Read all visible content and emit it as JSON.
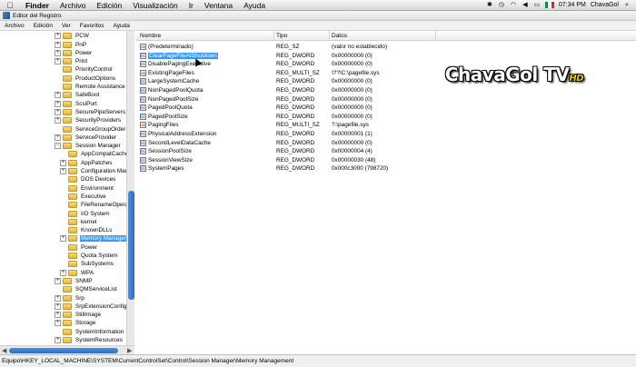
{
  "menubar": {
    "items": [
      "Finder",
      "Archivo",
      "Edición",
      "Visualización",
      "Ir",
      "Ventana",
      "Ayuda"
    ],
    "clock": "07:34 PM",
    "user": "ChavaGol"
  },
  "window": {
    "title": "Editor del Registro",
    "menu": [
      "Archivo",
      "Edición",
      "Ver",
      "Favoritos",
      "Ayuda"
    ]
  },
  "tree": {
    "items": [
      {
        "label": "PCW",
        "indent": 0,
        "expander": "+"
      },
      {
        "label": "PnP",
        "indent": 0,
        "expander": "+"
      },
      {
        "label": "Power",
        "indent": 0,
        "expander": "+"
      },
      {
        "label": "Print",
        "indent": 0,
        "expander": "+"
      },
      {
        "label": "PriorityControl",
        "indent": 0,
        "expander": ""
      },
      {
        "label": "ProductOptions",
        "indent": 0,
        "expander": ""
      },
      {
        "label": "Remote Assistance",
        "indent": 0,
        "expander": ""
      },
      {
        "label": "SafeBoot",
        "indent": 0,
        "expander": "+"
      },
      {
        "label": "ScsiPort",
        "indent": 0,
        "expander": "+"
      },
      {
        "label": "SecurePipeServers",
        "indent": 0,
        "expander": "+"
      },
      {
        "label": "SecurityProviders",
        "indent": 0,
        "expander": "+"
      },
      {
        "label": "ServiceGroupOrder",
        "indent": 0,
        "expander": ""
      },
      {
        "label": "ServiceProvider",
        "indent": 0,
        "expander": "+"
      },
      {
        "label": "Session Manager",
        "indent": 0,
        "expander": "−"
      },
      {
        "label": "AppCompatCache",
        "indent": 1,
        "expander": ""
      },
      {
        "label": "AppPatches",
        "indent": 1,
        "expander": "+"
      },
      {
        "label": "Configuration Manag",
        "indent": 1,
        "expander": "+"
      },
      {
        "label": "DOS Devices",
        "indent": 1,
        "expander": ""
      },
      {
        "label": "Environment",
        "indent": 1,
        "expander": ""
      },
      {
        "label": "Executive",
        "indent": 1,
        "expander": ""
      },
      {
        "label": "FileRenameOperation",
        "indent": 1,
        "expander": ""
      },
      {
        "label": "I/O System",
        "indent": 1,
        "expander": ""
      },
      {
        "label": "kernel",
        "indent": 1,
        "expander": ""
      },
      {
        "label": "KnownDLLs",
        "indent": 1,
        "expander": ""
      },
      {
        "label": "Memory Managemen",
        "indent": 1,
        "expander": "+",
        "selected": true
      },
      {
        "label": "Power",
        "indent": 1,
        "expander": ""
      },
      {
        "label": "Quota System",
        "indent": 1,
        "expander": ""
      },
      {
        "label": "SubSystems",
        "indent": 1,
        "expander": ""
      },
      {
        "label": "WPA",
        "indent": 1,
        "expander": "+"
      },
      {
        "label": "SNMP",
        "indent": 0,
        "expander": "+"
      },
      {
        "label": "SQMServiceList",
        "indent": 0,
        "expander": ""
      },
      {
        "label": "Srp",
        "indent": 0,
        "expander": "+"
      },
      {
        "label": "SrpExtensionConfig",
        "indent": 0,
        "expander": "+"
      },
      {
        "label": "StillImage",
        "indent": 0,
        "expander": "+"
      },
      {
        "label": "Storage",
        "indent": 0,
        "expander": "+"
      },
      {
        "label": "SystemInformation",
        "indent": 0,
        "expander": ""
      },
      {
        "label": "SystemResources",
        "indent": 0,
        "expander": "+"
      }
    ]
  },
  "values": {
    "headers": {
      "name": "Nombre",
      "type": "Tipo",
      "data": "Datos"
    },
    "rows": [
      {
        "name": "(Predeterminado)",
        "type": "REG_SZ",
        "data": "(valor no establecido)",
        "kind": "sz"
      },
      {
        "name": "ClearPageFileAtShutdown",
        "type": "REG_DWORD",
        "data": "0x00000000 (0)",
        "kind": "bin",
        "selected": true
      },
      {
        "name": "DisablePagingExecutive",
        "type": "REG_DWORD",
        "data": "0x00000000 (0)",
        "kind": "bin"
      },
      {
        "name": "ExistingPageFiles",
        "type": "REG_MULTI_SZ",
        "data": "\\??\\C:\\pagefile.sys",
        "kind": "sz"
      },
      {
        "name": "LargeSystemCache",
        "type": "REG_DWORD",
        "data": "0x00000000 (0)",
        "kind": "bin"
      },
      {
        "name": "NonPagedPoolQuota",
        "type": "REG_DWORD",
        "data": "0x00000000 (0)",
        "kind": "bin"
      },
      {
        "name": "NonPagedPoolSize",
        "type": "REG_DWORD",
        "data": "0x00000000 (0)",
        "kind": "bin"
      },
      {
        "name": "PagedPoolQuota",
        "type": "REG_DWORD",
        "data": "0x00000000 (0)",
        "kind": "bin"
      },
      {
        "name": "PagedPoolSize",
        "type": "REG_DWORD",
        "data": "0x00000000 (0)",
        "kind": "bin"
      },
      {
        "name": "PagingFiles",
        "type": "REG_MULTI_SZ",
        "data": "?:\\pagefile.sys",
        "kind": "sz"
      },
      {
        "name": "PhysicalAddressExtension",
        "type": "REG_DWORD",
        "data": "0x00000001 (1)",
        "kind": "bin"
      },
      {
        "name": "SecondLevelDataCache",
        "type": "REG_DWORD",
        "data": "0x00000000 (0)",
        "kind": "bin"
      },
      {
        "name": "SessionPoolSize",
        "type": "REG_DWORD",
        "data": "0x00000004 (4)",
        "kind": "bin"
      },
      {
        "name": "SessionViewSize",
        "type": "REG_DWORD",
        "data": "0x00000030 (48)",
        "kind": "bin"
      },
      {
        "name": "SystemPages",
        "type": "REG_DWORD",
        "data": "0x000c3000 (798720)",
        "kind": "bin"
      }
    ]
  },
  "watermark": {
    "text": "ChavaGol TV",
    "badge": "HD"
  },
  "statusbar": {
    "path": "Equipo\\HKEY_LOCAL_MACHINE\\SYSTEM\\CurrentControlSet\\Control\\Session Manager\\Memory Management"
  },
  "colors": {
    "selection": "#3399ff",
    "scroll": "#2a6ec9"
  }
}
